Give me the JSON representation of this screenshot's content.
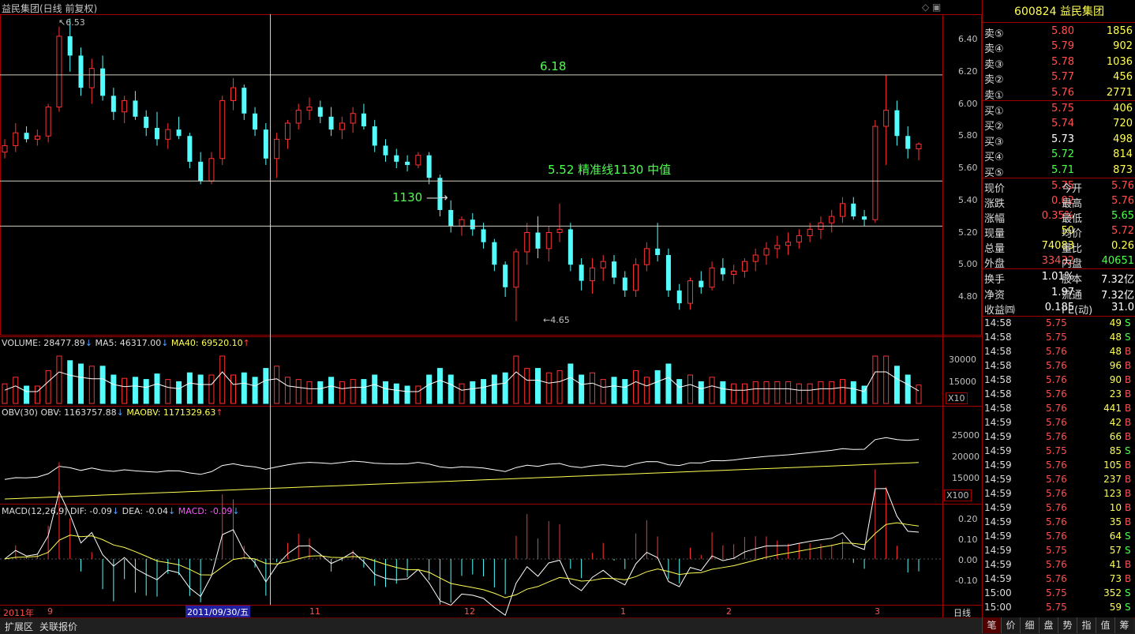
{
  "window_title": "益民集团(日线 前复权)",
  "price_axis_labels": [
    "6.40",
    "6.20",
    "6.00",
    "5.80",
    "5.60",
    "5.40",
    "5.20",
    "5.00",
    "4.80"
  ],
  "annotations": {
    "high": "6.53",
    "low": "4.65",
    "line_618": "6.18",
    "line_552": "5.52  精准线1130 中值",
    "arrow_1130": "1130"
  },
  "volume": {
    "label": "VOLUME: 28477.89",
    "ma5": "MA5: 46317.00",
    "ma40": "MA40: 69520.10",
    "axis": [
      "30000",
      "15000"
    ],
    "unit": "X10"
  },
  "obv": {
    "label": "OBV(30)",
    "obv": "OBV: 1163757.88",
    "maobv": "MAOBV: 1171329.63",
    "axis": [
      "25000",
      "20000",
      "15000"
    ],
    "unit": "X100"
  },
  "macd": {
    "label": "MACD(12,26,9)",
    "dif": "DIF: -0.09",
    "dea": "DEA: -0.04",
    "macd": "MACD: -0.09",
    "axis": [
      "0.20",
      "0.10",
      "0.00",
      "-0.10"
    ]
  },
  "date_axis": {
    "year": "2011年",
    "labels": [
      "9",
      "11",
      "12",
      "1",
      "2",
      "3"
    ],
    "cursor": "2011/09/30/五",
    "period": "日线"
  },
  "stock": {
    "code": "600824",
    "name": "益民集团"
  },
  "sell": [
    {
      "label": "卖⑤",
      "price": "5.80",
      "vol": "1856"
    },
    {
      "label": "卖④",
      "price": "5.79",
      "vol": "902"
    },
    {
      "label": "卖③",
      "price": "5.78",
      "vol": "1036"
    },
    {
      "label": "卖②",
      "price": "5.77",
      "vol": "456"
    },
    {
      "label": "卖①",
      "price": "5.76",
      "vol": "2771"
    }
  ],
  "buy": [
    {
      "label": "买①",
      "price": "5.75",
      "vol": "406"
    },
    {
      "label": "买②",
      "price": "5.74",
      "vol": "720"
    },
    {
      "label": "买③",
      "price": "5.73",
      "vol": "498"
    },
    {
      "label": "买④",
      "price": "5.72",
      "vol": "814"
    },
    {
      "label": "买⑤",
      "price": "5.71",
      "vol": "873"
    }
  ],
  "quote": [
    {
      "k1": "现价",
      "v1": "5.75",
      "k2": "今开",
      "v2": "5.76"
    },
    {
      "k1": "涨跌",
      "v1": "0.02",
      "k2": "最高",
      "v2": "5.76"
    },
    {
      "k1": "涨幅",
      "v1": "0.35%",
      "k2": "最低",
      "v2": "5.65"
    },
    {
      "k1": "现量",
      "v1": "50",
      "k2": "均价",
      "v2": "5.72"
    },
    {
      "k1": "总量",
      "v1": "74083",
      "k2": "量比",
      "v2": "0.26"
    },
    {
      "k1": "外盘",
      "v1": "33432",
      "k2": "内盘",
      "v2": "40651"
    }
  ],
  "fund": [
    {
      "k1": "换手",
      "v1": "1.01%",
      "k2": "股本",
      "v2": "7.32亿"
    },
    {
      "k1": "净资",
      "v1": "1.97",
      "k2": "流通",
      "v2": "7.32亿"
    },
    {
      "k1": "收益㈣",
      "v1": "0.185",
      "k2": "PE(动)",
      "v2": "31.0"
    }
  ],
  "ticks": [
    [
      "14:58",
      "5.75",
      "49",
      "S"
    ],
    [
      "14:58",
      "5.75",
      "48",
      "S"
    ],
    [
      "14:58",
      "5.76",
      "48",
      "B"
    ],
    [
      "14:58",
      "5.76",
      "96",
      "B"
    ],
    [
      "14:58",
      "5.76",
      "90",
      "B"
    ],
    [
      "14:58",
      "5.76",
      "23",
      "B"
    ],
    [
      "14:58",
      "5.76",
      "441",
      "B"
    ],
    [
      "14:59",
      "5.76",
      "42",
      "B"
    ],
    [
      "14:59",
      "5.76",
      "66",
      "B"
    ],
    [
      "14:59",
      "5.75",
      "85",
      "S"
    ],
    [
      "14:59",
      "5.76",
      "105",
      "B"
    ],
    [
      "14:59",
      "5.76",
      "237",
      "B"
    ],
    [
      "14:59",
      "5.76",
      "123",
      "B"
    ],
    [
      "14:59",
      "5.76",
      "10",
      "B"
    ],
    [
      "14:59",
      "5.76",
      "35",
      "B"
    ],
    [
      "14:59",
      "5.76",
      "64",
      "S"
    ],
    [
      "14:59",
      "5.75",
      "57",
      "S"
    ],
    [
      "14:59",
      "5.76",
      "41",
      "B"
    ],
    [
      "14:59",
      "5.76",
      "73",
      "B"
    ],
    [
      "15:00",
      "5.75",
      "352",
      "S"
    ],
    [
      "15:00",
      "5.75",
      "59",
      "S"
    ]
  ],
  "bottom_tabs": [
    "扩展区",
    "关联报价"
  ],
  "right_tabs": [
    "笔",
    "价",
    "细",
    "盘",
    "势",
    "指",
    "值",
    "筹"
  ],
  "colors": {
    "up": "#ff3232",
    "down": "#54fcfc",
    "grid": "#a00000",
    "yellow": "#ffff00",
    "green": "#00e600"
  },
  "chart_data": {
    "type": "candlestick",
    "title": "益民集团(日线 前复权)",
    "ylim": [
      4.6,
      6.6
    ],
    "horizontal_lines": [
      6.18,
      5.52,
      5.24
    ],
    "ohlc_approx": [
      [
        5.7,
        5.78,
        5.66,
        5.74
      ],
      [
        5.74,
        5.88,
        5.7,
        5.82
      ],
      [
        5.82,
        5.86,
        5.76,
        5.78
      ],
      [
        5.78,
        5.84,
        5.74,
        5.8
      ],
      [
        5.8,
        6.0,
        5.76,
        5.98
      ],
      [
        5.98,
        6.48,
        5.95,
        6.42
      ],
      [
        6.42,
        6.53,
        6.2,
        6.3
      ],
      [
        6.3,
        6.35,
        6.05,
        6.1
      ],
      [
        6.1,
        6.28,
        6.0,
        6.22
      ],
      [
        6.22,
        6.3,
        6.02,
        6.05
      ],
      [
        6.05,
        6.1,
        5.9,
        5.95
      ],
      [
        5.95,
        6.05,
        5.88,
        6.02
      ],
      [
        6.02,
        6.08,
        5.9,
        5.92
      ],
      [
        5.92,
        5.96,
        5.8,
        5.85
      ],
      [
        5.85,
        5.95,
        5.74,
        5.78
      ],
      [
        5.78,
        5.88,
        5.72,
        5.84
      ],
      [
        5.84,
        5.92,
        5.78,
        5.8
      ],
      [
        5.8,
        5.82,
        5.6,
        5.64
      ],
      [
        5.64,
        5.7,
        5.5,
        5.52
      ],
      [
        5.52,
        5.7,
        5.5,
        5.66
      ],
      [
        5.66,
        6.05,
        5.62,
        6.02
      ],
      [
        6.02,
        6.16,
        5.96,
        6.1
      ],
      [
        6.1,
        6.12,
        5.9,
        5.94
      ],
      [
        5.94,
        5.98,
        5.8,
        5.84
      ],
      [
        5.84,
        5.88,
        5.62,
        5.66
      ],
      [
        5.66,
        5.82,
        5.54,
        5.78
      ],
      [
        5.78,
        5.9,
        5.72,
        5.88
      ],
      [
        5.88,
        6.0,
        5.84,
        5.96
      ],
      [
        5.96,
        6.04,
        5.9,
        5.98
      ],
      [
        5.98,
        6.02,
        5.88,
        5.92
      ],
      [
        5.92,
        5.98,
        5.8,
        5.84
      ],
      [
        5.84,
        5.92,
        5.78,
        5.88
      ],
      [
        5.88,
        5.98,
        5.82,
        5.94
      ],
      [
        5.94,
        6.0,
        5.84,
        5.86
      ],
      [
        5.86,
        5.9,
        5.7,
        5.74
      ],
      [
        5.74,
        5.78,
        5.64,
        5.68
      ],
      [
        5.68,
        5.72,
        5.6,
        5.64
      ],
      [
        5.64,
        5.68,
        5.58,
        5.62
      ],
      [
        5.62,
        5.7,
        5.6,
        5.68
      ],
      [
        5.68,
        5.7,
        5.5,
        5.54
      ],
      [
        5.54,
        5.56,
        5.3,
        5.34
      ],
      [
        5.34,
        5.4,
        5.2,
        5.24
      ],
      [
        5.24,
        5.3,
        5.18,
        5.28
      ],
      [
        5.28,
        5.32,
        5.18,
        5.22
      ],
      [
        5.22,
        5.26,
        5.1,
        5.14
      ],
      [
        5.14,
        5.16,
        4.96,
        5.0
      ],
      [
        5.0,
        5.02,
        4.8,
        4.86
      ],
      [
        4.86,
        5.1,
        4.65,
        5.08
      ],
      [
        5.08,
        5.26,
        5.0,
        5.2
      ],
      [
        5.2,
        5.3,
        5.04,
        5.1
      ],
      [
        5.1,
        5.24,
        5.02,
        5.2
      ],
      [
        5.2,
        5.38,
        5.14,
        5.22
      ],
      [
        5.22,
        5.26,
        4.96,
        5.0
      ],
      [
        5.0,
        5.04,
        4.84,
        4.9
      ],
      [
        4.9,
        5.04,
        4.82,
        4.98
      ],
      [
        4.98,
        5.06,
        4.9,
        5.02
      ],
      [
        5.02,
        5.06,
        4.88,
        4.92
      ],
      [
        4.92,
        4.96,
        4.8,
        4.84
      ],
      [
        4.84,
        5.04,
        4.8,
        5.0
      ],
      [
        5.0,
        5.14,
        4.96,
        5.1
      ],
      [
        5.1,
        5.26,
        5.02,
        5.06
      ],
      [
        5.06,
        5.1,
        4.8,
        4.84
      ],
      [
        4.84,
        4.88,
        4.72,
        4.76
      ],
      [
        4.76,
        4.92,
        4.72,
        4.9
      ],
      [
        4.9,
        4.96,
        4.82,
        4.86
      ],
      [
        4.86,
        5.02,
        4.84,
        4.98
      ],
      [
        4.98,
        5.04,
        4.9,
        4.94
      ],
      [
        4.94,
        5.0,
        4.88,
        4.96
      ],
      [
        4.96,
        5.04,
        4.92,
        5.02
      ],
      [
        5.02,
        5.1,
        4.96,
        5.06
      ],
      [
        5.06,
        5.14,
        5.0,
        5.1
      ],
      [
        5.1,
        5.18,
        5.04,
        5.12
      ],
      [
        5.12,
        5.2,
        5.06,
        5.14
      ],
      [
        5.14,
        5.22,
        5.1,
        5.18
      ],
      [
        5.18,
        5.26,
        5.14,
        5.22
      ],
      [
        5.22,
        5.3,
        5.16,
        5.26
      ],
      [
        5.26,
        5.34,
        5.2,
        5.3
      ],
      [
        5.3,
        5.42,
        5.26,
        5.38
      ],
      [
        5.38,
        5.42,
        5.28,
        5.3
      ],
      [
        5.3,
        5.34,
        5.24,
        5.28
      ],
      [
        5.28,
        5.9,
        5.26,
        5.86
      ],
      [
        5.86,
        6.18,
        5.62,
        5.96
      ],
      [
        5.96,
        6.02,
        5.74,
        5.8
      ],
      [
        5.8,
        5.86,
        5.66,
        5.72
      ],
      [
        5.72,
        5.76,
        5.65,
        5.75
      ]
    ]
  }
}
